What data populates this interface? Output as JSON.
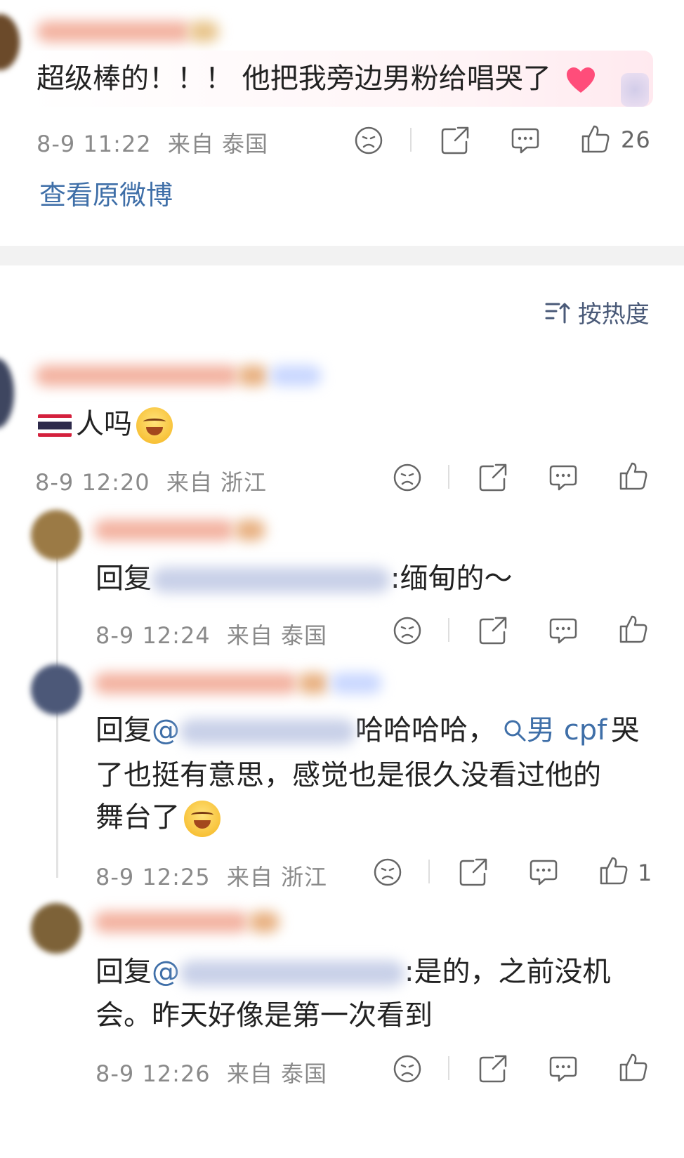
{
  "original": {
    "text": "超级棒的！！！ 他把我旁边男粉给唱哭了",
    "time": "8-9 11:22",
    "source": "来自 泰国",
    "like_count": "26",
    "view_original": "查看原微博"
  },
  "sort": {
    "label": "按热度"
  },
  "comments": [
    {
      "text_main": "人吗",
      "time": "8-9 12:20",
      "source": "来自 浙江",
      "like_count": ""
    },
    {
      "prefix": "回复",
      "suffix": ":缅甸的～",
      "time": "8-9 12:24",
      "source": "来自 泰国",
      "like_count": ""
    },
    {
      "prefix": "回复",
      "at": "@",
      "line1_after": "哈哈哈哈，",
      "topic": "男 cpf",
      "line1_end": "哭",
      "line2": "了也挺有意思，感觉也是很久没看过他的",
      "line3": "舞台了",
      "time": "8-9 12:25",
      "source": "来自 浙江",
      "like_count": "1"
    },
    {
      "prefix": "回复",
      "at": "@",
      "line1_after": ":是的，之前没机",
      "line2": "会。昨天好像是第一次看到",
      "time": "8-9 12:26",
      "source": "来自 泰国",
      "like_count": ""
    }
  ]
}
